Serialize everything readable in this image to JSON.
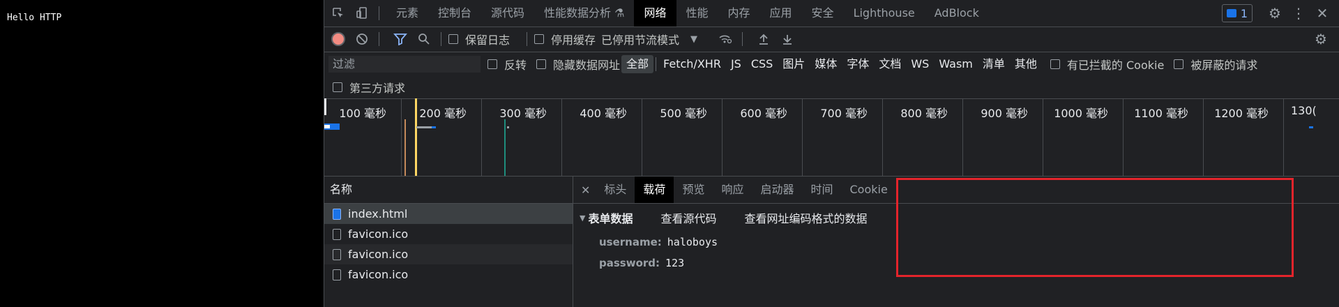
{
  "page": {
    "text": "Hello HTTP"
  },
  "devtools": {
    "tabs": [
      "元素",
      "控制台",
      "源代码",
      "性能数据分析 ⚗",
      "网络",
      "性能",
      "内存",
      "应用",
      "安全",
      "Lighthouse",
      "AdBlock"
    ],
    "active_tab": "网络",
    "issues_count": "1",
    "toolbar": {
      "preserve_log": "保留日志",
      "disable_cache": "停用缓存",
      "throttling": "已停用节流模式"
    },
    "filter": {
      "placeholder": "过滤",
      "invert": "反转",
      "hide_data_urls": "隐藏数据网址",
      "types": [
        "全部",
        "Fetch/XHR",
        "JS",
        "CSS",
        "图片",
        "媒体",
        "字体",
        "文档",
        "WS",
        "Wasm",
        "清单",
        "其他"
      ],
      "active_type": "全部",
      "blocked_cookies": "有已拦截的 Cookie",
      "blocked_requests": "被屏蔽的请求",
      "third_party": "第三方请求"
    },
    "timeline": {
      "ticks": [
        "100 毫秒",
        "200 毫秒",
        "300 毫秒",
        "400 毫秒",
        "500 毫秒",
        "600 毫秒",
        "700 毫秒",
        "800 毫秒",
        "900 毫秒",
        "1000 毫秒",
        "1100 毫秒",
        "1200 毫秒",
        "130("
      ]
    },
    "requests": {
      "header": "名称",
      "rows": [
        "index.html",
        "favicon.ico",
        "favicon.ico",
        "favicon.ico"
      ]
    },
    "detail": {
      "tabs": [
        "标头",
        "载荷",
        "预览",
        "响应",
        "启动器",
        "时间",
        "Cookie"
      ],
      "active_tab": "载荷",
      "form_title": "表单数据",
      "view_source": "查看源代码",
      "view_url_encoded": "查看网址编码格式的数据",
      "fields": [
        {
          "key": "username:",
          "value": "haloboys"
        },
        {
          "key": "password:",
          "value": "123"
        }
      ]
    }
  }
}
